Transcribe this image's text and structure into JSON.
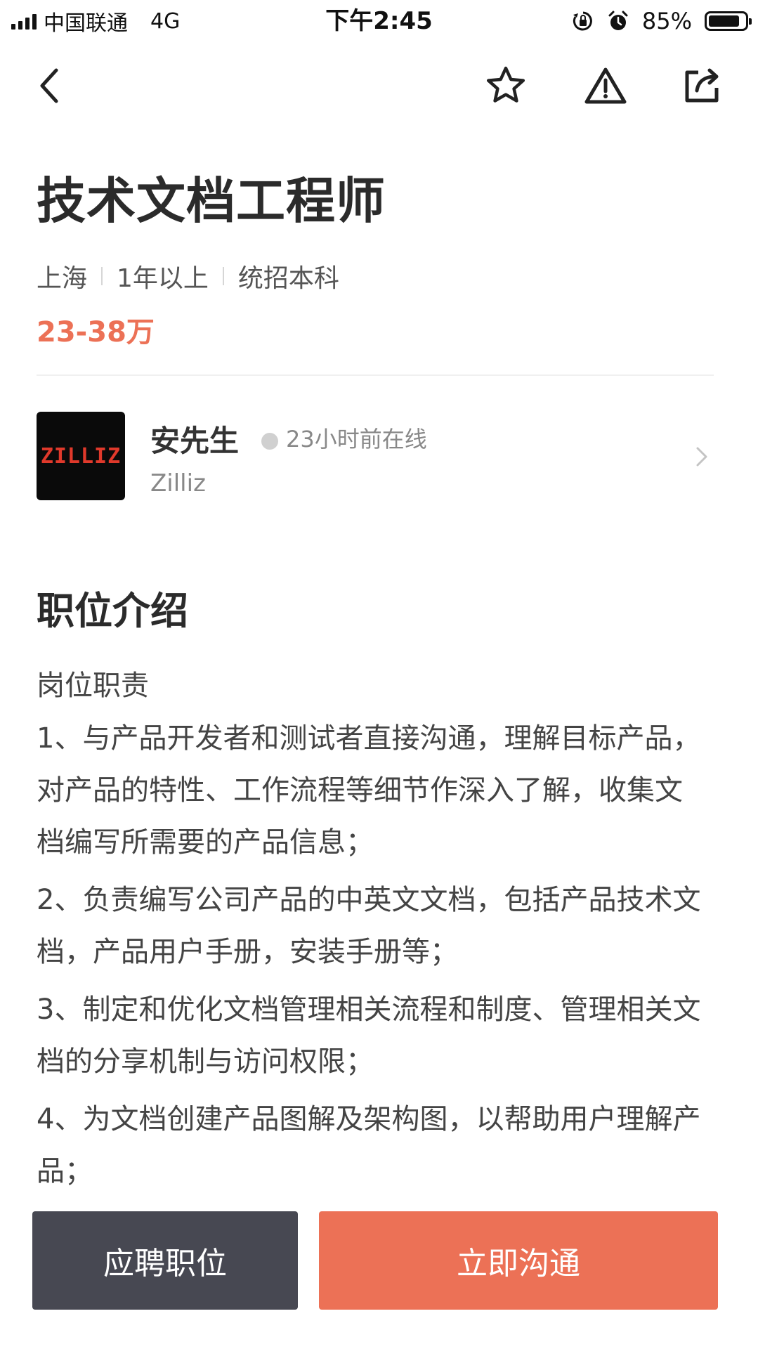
{
  "status_bar": {
    "carrier": "中国联通",
    "network": "4G",
    "time": "下午2:45",
    "battery_percent": "85%",
    "battery_level": 0.85,
    "icons": [
      "signal-icon",
      "orientation-lock-icon",
      "alarm-icon",
      "battery-icon"
    ]
  },
  "nav": {
    "icons": [
      "back-icon",
      "star-icon",
      "warning-icon",
      "share-icon"
    ]
  },
  "job": {
    "title": "技术文档工程师",
    "location": "上海",
    "experience": "1年以上",
    "education": "统招本科",
    "salary": "23-38万"
  },
  "recruiter": {
    "logo_text": "ZILLIZ",
    "name": "安先生",
    "online_status": "23小时前在线",
    "company": "Zilliz"
  },
  "description": {
    "title": "职位介绍",
    "subtitle": "岗位职责",
    "duties": [
      "1、与产品开发者和测试者直接沟通，理解目标产品，对产品的特性、工作流程等细节作深入了解，收集文档编写所需要的产品信息；",
      "2、负责编写公司产品的中英文文档，包括产品技术文档，产品用户手册，安装手册等；",
      "3、制定和优化文档管理相关流程和制度、管理相关文档的分享机制与访问权限；",
      "4、为文档创建产品图解及架构图，以帮助用户理解产品；"
    ]
  },
  "actions": {
    "apply_label": "应聘职位",
    "chat_label": "立即沟通"
  },
  "colors": {
    "accent": "#ec7156",
    "dark_button": "#474852",
    "title_text": "#2b2b2b"
  }
}
